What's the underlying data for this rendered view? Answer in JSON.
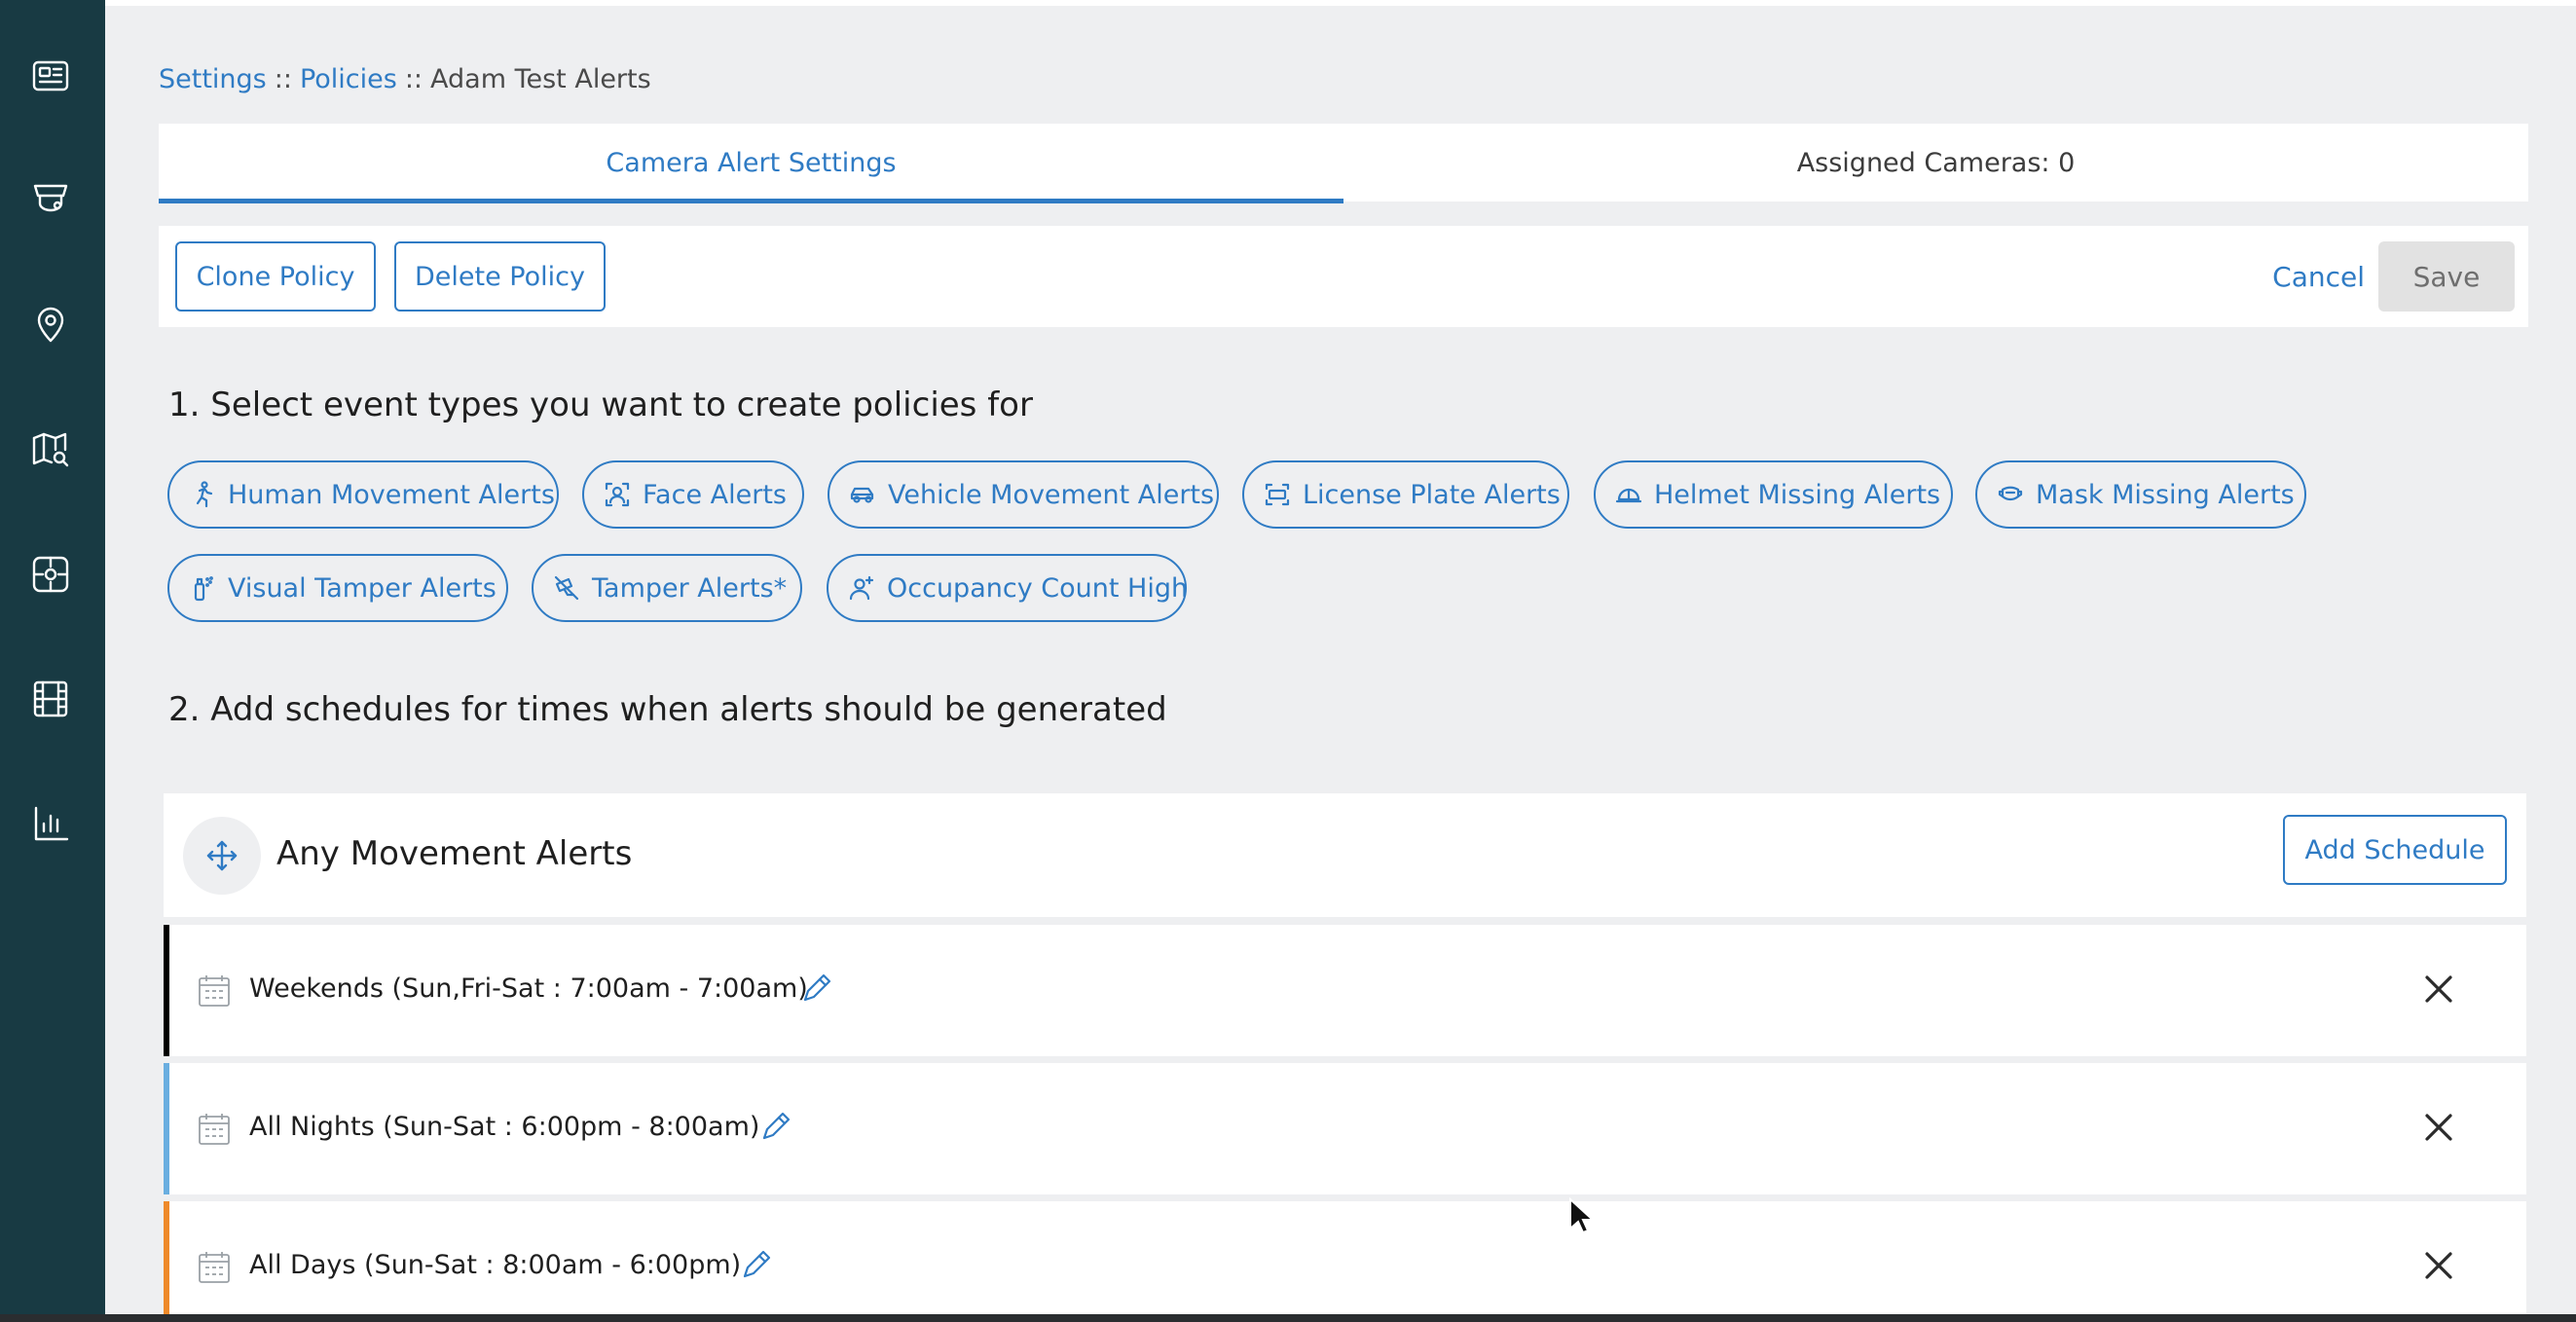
{
  "breadcrumb": {
    "settings": "Settings",
    "policies": "Policies",
    "current": "Adam Test Alerts",
    "separator": "::"
  },
  "tabs": [
    {
      "label": "Camera Alert Settings",
      "active": true
    },
    {
      "label": "Assigned Cameras: 0",
      "active": false
    }
  ],
  "toolbar": {
    "clone": "Clone Policy",
    "delete": "Delete Policy",
    "cancel": "Cancel",
    "save": "Save"
  },
  "sections": {
    "event_types": "1. Select event types you want to create policies for",
    "schedules": "2. Add schedules for times when alerts should be generated"
  },
  "event_chips": [
    {
      "label": "Human Movement Alerts",
      "icon": "running-person-icon"
    },
    {
      "label": "Face Alerts",
      "icon": "face-scan-icon"
    },
    {
      "label": "Vehicle Movement Alerts",
      "icon": "car-icon"
    },
    {
      "label": "License Plate Alerts",
      "icon": "license-plate-icon"
    },
    {
      "label": "Helmet Missing Alerts",
      "icon": "helmet-icon"
    },
    {
      "label": "Mask Missing Alerts",
      "icon": "mask-icon"
    },
    {
      "label": "Visual Tamper Alerts",
      "icon": "spray-can-icon"
    },
    {
      "label": "Tamper Alerts*",
      "icon": "tamper-camera-icon"
    },
    {
      "label": "Occupancy Count High",
      "icon": "person-plus-icon"
    }
  ],
  "schedule_card": {
    "title": "Any Movement Alerts",
    "add_button": "Add Schedule",
    "rows": [
      {
        "label": "Weekends (Sun,Fri-Sat : 7:00am - 7:00am)",
        "color": "#000000"
      },
      {
        "label": "All Nights (Sun-Sat : 6:00pm - 8:00am)",
        "color": "#6aaee0"
      },
      {
        "label": "All Days (Sun-Sat : 8:00am - 6:00pm)",
        "color": "#ee8a2a"
      }
    ]
  },
  "colors": {
    "accent": "#2f7bc4",
    "sidebar": "#183a43"
  }
}
